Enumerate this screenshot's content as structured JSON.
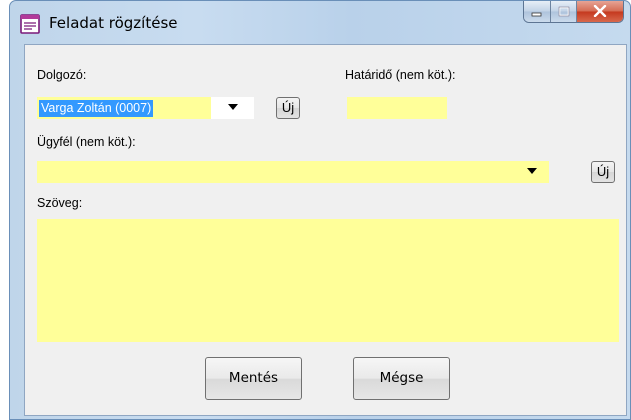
{
  "window": {
    "title": "Feladat rögzítése"
  },
  "icons": {
    "app": "form-document-icon",
    "minimize": "minimize-icon",
    "maximize": "maximize-icon",
    "close": "close-icon",
    "dropdown": "chevron-down-icon"
  },
  "form": {
    "employee_label": "Dolgozó:",
    "employee_value": "Varga Zoltán (0007)",
    "new_employee_button": "Új",
    "deadline_label": "Határidő (nem köt.):",
    "deadline_value": "",
    "client_label": "Ügyfél (nem köt.):",
    "client_value": "",
    "new_client_button": "Új",
    "text_label": "Szöveg:",
    "text_value": ""
  },
  "buttons": {
    "save": "Mentés",
    "cancel": "Mégse"
  },
  "colors": {
    "input_background": "#ffff99",
    "selection": "#3399ff",
    "close_button": "#c4381e"
  }
}
